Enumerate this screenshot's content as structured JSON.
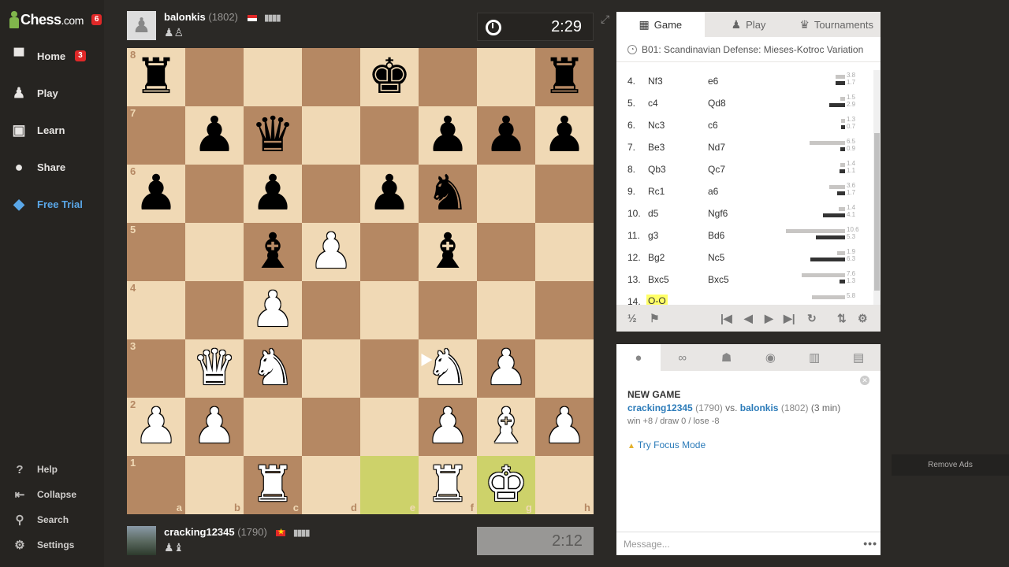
{
  "sidebar": {
    "logo_text": "Chess",
    "logo_suffix": ".com",
    "logo_badge": "6",
    "items": [
      {
        "label": "Home",
        "icon": "home-icon",
        "glyph": "▀",
        "badge": "3"
      },
      {
        "label": "Play",
        "icon": "play-icon",
        "glyph": "♟"
      },
      {
        "label": "Learn",
        "icon": "learn-icon",
        "glyph": "▣"
      },
      {
        "label": "Share",
        "icon": "share-icon",
        "glyph": "●"
      },
      {
        "label": "Free Trial",
        "icon": "diamond-icon",
        "glyph": "◆"
      }
    ],
    "bottom_items": [
      {
        "label": "Help",
        "icon": "help-icon",
        "glyph": "?"
      },
      {
        "label": "Collapse",
        "icon": "collapse-icon",
        "glyph": "⇤"
      },
      {
        "label": "Search",
        "icon": "search-icon",
        "glyph": "⚲"
      },
      {
        "label": "Settings",
        "icon": "settings-icon",
        "glyph": "⚙"
      }
    ]
  },
  "top_player": {
    "name": "balonkis",
    "rating": "(1802)",
    "captured": "♟♙",
    "clock": "2:29"
  },
  "bottom_player": {
    "name": "cracking12345",
    "rating": "(1790)",
    "captured": "♟♝",
    "clock": "2:12"
  },
  "board": {
    "ranks": [
      "8",
      "7",
      "6",
      "5",
      "4",
      "3",
      "2",
      "1"
    ],
    "files": [
      "a",
      "b",
      "c",
      "d",
      "e",
      "f",
      "g",
      "h"
    ],
    "pieces": [
      [
        "r",
        null,
        null,
        null,
        "k",
        null,
        null,
        "r"
      ],
      [
        null,
        "p",
        "q",
        null,
        null,
        "p",
        "p",
        "p"
      ],
      [
        "p",
        null,
        "p",
        null,
        "p",
        "n",
        null,
        null
      ],
      [
        null,
        null,
        "b",
        "P",
        null,
        "b",
        null,
        null
      ],
      [
        null,
        null,
        "P",
        null,
        null,
        null,
        null,
        null
      ],
      [
        null,
        "Q",
        "N",
        null,
        null,
        "N",
        "P",
        null
      ],
      [
        "P",
        "P",
        null,
        null,
        null,
        "P",
        "B",
        "P"
      ],
      [
        null,
        null,
        "R",
        null,
        null,
        "R",
        "K",
        null
      ]
    ],
    "highlights": [
      "e1",
      "g1"
    ]
  },
  "game_panel": {
    "tabs": [
      {
        "label": "Game",
        "icon": "game-icon",
        "glyph": "▦"
      },
      {
        "label": "Play",
        "icon": "play-tab-icon",
        "glyph": "♟"
      },
      {
        "label": "Tournaments",
        "icon": "trophy-icon",
        "glyph": "♛"
      }
    ],
    "opening": "B01: Scandinavian Defense: Mieses-Kotroc Variation",
    "moves": [
      {
        "num": "4.",
        "w": "Nf3",
        "b": "e6",
        "tw": "3.8",
        "tb": "1.7",
        "bw": 0.12,
        "bb": 0.12
      },
      {
        "num": "5.",
        "w": "c4",
        "b": "Qd8",
        "tw": "1.5",
        "tb": "2.9",
        "bw": 0.06,
        "bb": 0.2
      },
      {
        "num": "6.",
        "w": "Nc3",
        "b": "c6",
        "tw": "1.3",
        "tb": "0.7",
        "bw": 0.05,
        "bb": 0.05
      },
      {
        "num": "7.",
        "w": "Be3",
        "b": "Nd7",
        "tw": "6.5",
        "tb": "0.9",
        "bw": 0.45,
        "bb": 0.06
      },
      {
        "num": "8.",
        "w": "Qb3",
        "b": "Qc7",
        "tw": "1.4",
        "tb": "1.1",
        "bw": 0.06,
        "bb": 0.07
      },
      {
        "num": "9.",
        "w": "Rc1",
        "b": "a6",
        "tw": "3.6",
        "tb": "1.7",
        "bw": 0.2,
        "bb": 0.1
      },
      {
        "num": "10.",
        "w": "d5",
        "b": "Ngf6",
        "tw": "1.4",
        "tb": "4.1",
        "bw": 0.08,
        "bb": 0.28
      },
      {
        "num": "11.",
        "w": "g3",
        "b": "Bd6",
        "tw": "10.6",
        "tb": "5.3",
        "bw": 0.75,
        "bb": 0.37
      },
      {
        "num": "12.",
        "w": "Bg2",
        "b": "Nc5",
        "tw": "1.9",
        "tb": "6.3",
        "bw": 0.1,
        "bb": 0.44
      },
      {
        "num": "13.",
        "w": "Bxc5",
        "b": "Bxc5",
        "tw": "7.6",
        "tb": "1.3",
        "bw": 0.55,
        "bb": 0.07
      },
      {
        "num": "14.",
        "w": "O-O",
        "b": "",
        "tw": "5.8",
        "tb": "",
        "bw": 0.42,
        "bb": 0
      }
    ],
    "controls": {
      "draw": "½",
      "flag": "⚑",
      "first": "|◀",
      "prev": "◀",
      "next": "▶",
      "last": "▶|",
      "refresh": "↻",
      "flip": "⇅",
      "settings": "⚙"
    }
  },
  "chat_panel": {
    "tab_icons": [
      "chat-icon",
      "binoculars-icon",
      "friends-icon",
      "messages-icon",
      "explore-icon",
      "archive-icon"
    ],
    "tab_glyphs": [
      "●",
      "∞",
      "☗",
      "◉",
      "▥",
      "▤"
    ],
    "title": "NEW GAME",
    "player1": "cracking12345",
    "rating1": "(1790)",
    "vs": "vs.",
    "player2": "balonkis",
    "rating2": "(1802)",
    "time_control": "(3 min)",
    "score": "win +8 / draw 0 / lose -8",
    "focus_mode": "Try Focus Mode",
    "message_placeholder": "Message..."
  },
  "remove_ads": "Remove Ads"
}
